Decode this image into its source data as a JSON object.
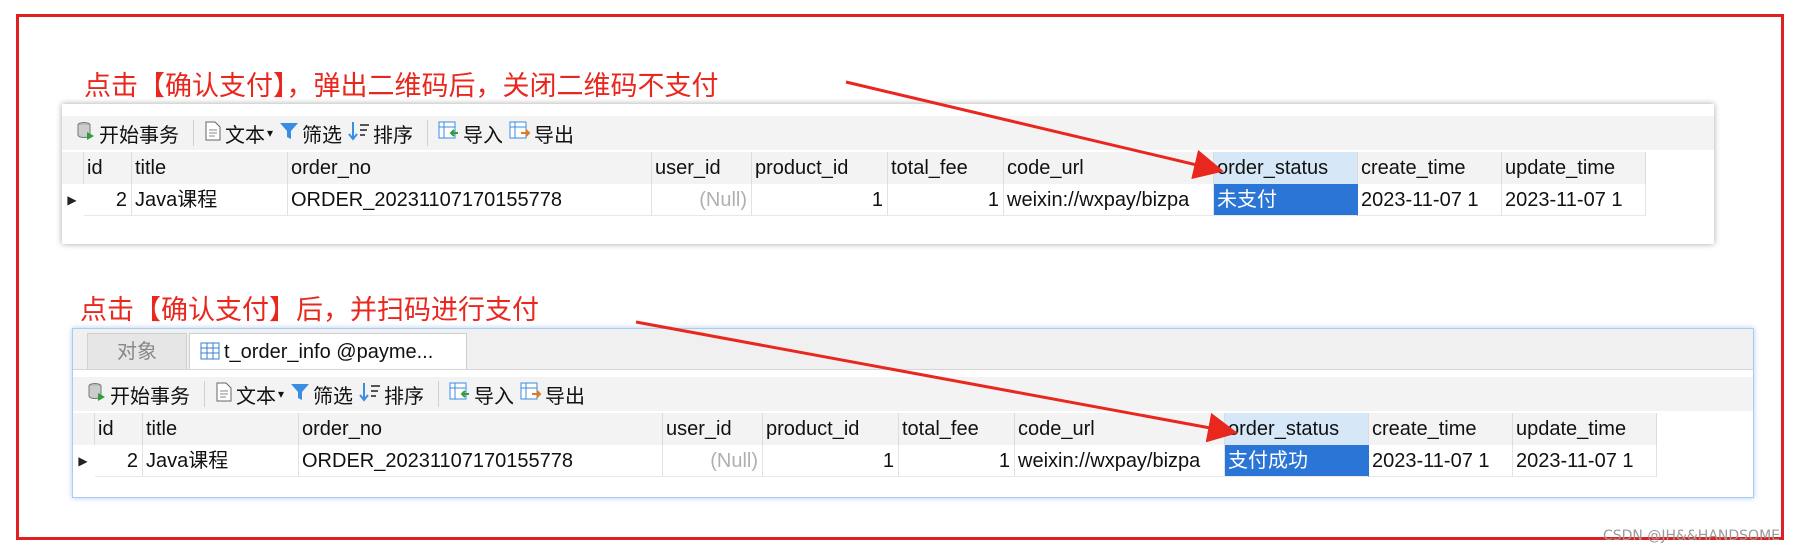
{
  "captions": {
    "top": "点击【确认支付】，弹出二维码后，关闭二维码不支付",
    "bottom": "点击【确认支付】后，并扫码进行支付"
  },
  "toolbar": {
    "begin_transaction": "开始事务",
    "text": "文本",
    "filter": "筛选",
    "sort": "排序",
    "import": "导入",
    "export": "导出"
  },
  "tabs": {
    "objects": "对象",
    "table": "t_order_info @payme..."
  },
  "columns": [
    "id",
    "title",
    "order_no",
    "user_id",
    "product_id",
    "total_fee",
    "code_url",
    "order_status",
    "create_time",
    "update_time"
  ],
  "rows_before": [
    {
      "id": "2",
      "title": "Java课程",
      "order_no": "ORDER_20231107170155778",
      "user_id": "(Null)",
      "product_id": "1",
      "total_fee": "1",
      "code_url": "weixin://wxpay/bizpa",
      "order_status": "未支付",
      "create_time": "2023-11-07 1",
      "update_time": "2023-11-07 1"
    }
  ],
  "rows_after": [
    {
      "id": "2",
      "title": "Java课程",
      "order_no": "ORDER_20231107170155778",
      "user_id": "(Null)",
      "product_id": "1",
      "total_fee": "1",
      "code_url": "weixin://wxpay/bizpa",
      "order_status": "支付成功",
      "create_time": "2023-11-07 1",
      "update_time": "2023-11-07 1"
    }
  ],
  "watermark": "CSDN @JH&&HANDSOME",
  "colors": {
    "frame": "#e02020",
    "caption": "#e8281e",
    "selection": "#2b75d6",
    "arrow": "#e8281e"
  }
}
